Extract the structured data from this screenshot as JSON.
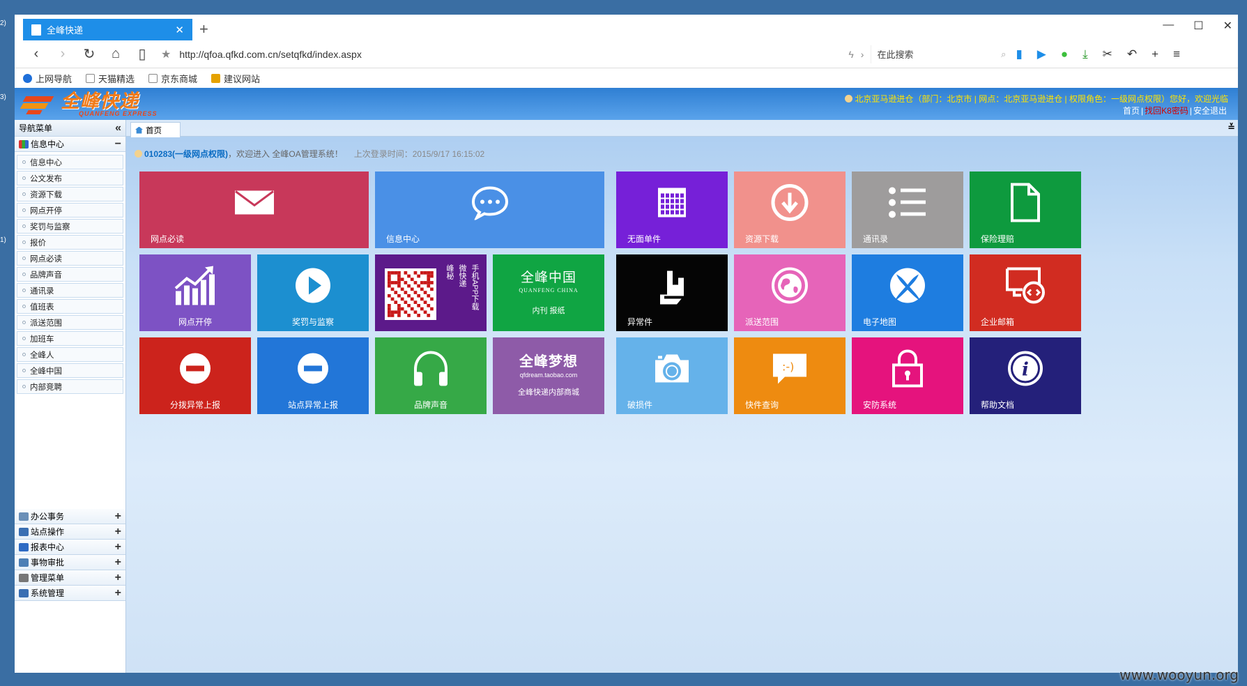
{
  "edge_marks": [
    "2)",
    "3)",
    "1)"
  ],
  "browser": {
    "tab_title": "全峰快递",
    "url": "http://qfoa.qfkd.com.cn/setqfkd/index.aspx",
    "search_placeholder": "在此搜索",
    "bookmarks": [
      "上网导航",
      "天猫精选",
      "京东商城",
      "建议网站"
    ]
  },
  "header": {
    "logo_cn": "全峰快递",
    "logo_en": "QUANFENG EXPRESS",
    "info_line": "北京亚马逊进仓（部门：北京市 | 网点：北京亚马逊进仓 | 权限角色：一级网点权限）您好，欢迎光临",
    "links": [
      "首页",
      "找回K8密码",
      "安全退出"
    ]
  },
  "sidebar": {
    "title": "导航菜单",
    "active_group": "信息中心",
    "items": [
      "信息中心",
      "公文发布",
      "资源下载",
      "网点开停",
      "奖罚与监察",
      "报价",
      "网点必读",
      "品牌声音",
      "通讯录",
      "值班表",
      "派送范围",
      "加班车",
      "全峰人",
      "全峰中国",
      "内部竞聘"
    ],
    "groups": [
      "办公事务",
      "站点操作",
      "报表中心",
      "事物审批",
      "管理菜单",
      "系统管理"
    ]
  },
  "main": {
    "tab": "首页",
    "welcome_user": "010283(一级网点权限)",
    "welcome_text": "，欢迎进入 全峰OA管理系统！",
    "last_login": "上次登录时间：2015/9/17 16:15:02"
  },
  "tiles": [
    {
      "label": "网点必读",
      "color": "#c8385a",
      "icon": "mail-icon"
    },
    {
      "label": "信息中心",
      "color": "#4a90e6",
      "icon": "chat-icon"
    },
    {
      "label": "无面单件",
      "color": "#7620d8",
      "icon": "calendar-icon"
    },
    {
      "label": "资源下载",
      "color": "#f1918c",
      "icon": "download-icon"
    },
    {
      "label": "通讯录",
      "color": "#9e9c9c",
      "icon": "list-icon"
    },
    {
      "label": "保险理赔",
      "color": "#0e9a3e",
      "icon": "document-icon"
    },
    {
      "label": "网点开停",
      "color": "#7d52c4",
      "icon": "chart-icon"
    },
    {
      "label": "奖罚与监察",
      "color": "#1c8fd0",
      "icon": "play-icon"
    },
    {
      "label": "手机APP下载",
      "color": "#5c1a8a",
      "icon": "qrcode-icon",
      "extra": [
        "峰",
        "秘",
        "微",
        "快",
        "递",
        "手",
        "机",
        "APP",
        "下",
        "载"
      ]
    },
    {
      "label": "内刊 报纸",
      "color": "#10a543",
      "icon": "brand-text-icon",
      "extra": [
        "全峰中国",
        "QUANFENG CHINA"
      ]
    },
    {
      "label": "异常件",
      "color": "#050505",
      "icon": "stairs-icon"
    },
    {
      "label": "派送范围",
      "color": "#e664b9",
      "icon": "globe-icon"
    },
    {
      "label": "电子地图",
      "color": "#1e7de0",
      "icon": "xbox-icon"
    },
    {
      "label": "企业邮箱",
      "color": "#d12c21",
      "icon": "remote-icon"
    },
    {
      "label": "分拨异常上报",
      "color": "#cc231c",
      "icon": "minus-icon"
    },
    {
      "label": "站点异常上报",
      "color": "#2276d8",
      "icon": "minus-icon"
    },
    {
      "label": "品牌声音",
      "color": "#36a947",
      "icon": "headphones-icon"
    },
    {
      "label": "全峰快递内部商城",
      "color": "#8e5ba8",
      "icon": "brand-text-icon",
      "extra": [
        "全峰梦想",
        "qfdream.taobao.com"
      ]
    },
    {
      "label": "破损件",
      "color": "#65b2ea",
      "icon": "camera-icon"
    },
    {
      "label": "快件查询",
      "color": "#ee8b10",
      "icon": "smile-chat-icon"
    },
    {
      "label": "安防系统",
      "color": "#e5137d",
      "icon": "lock-icon"
    },
    {
      "label": "帮助文档",
      "color": "#24207a",
      "icon": "info-icon"
    }
  ],
  "watermark": "www.wooyun.org"
}
